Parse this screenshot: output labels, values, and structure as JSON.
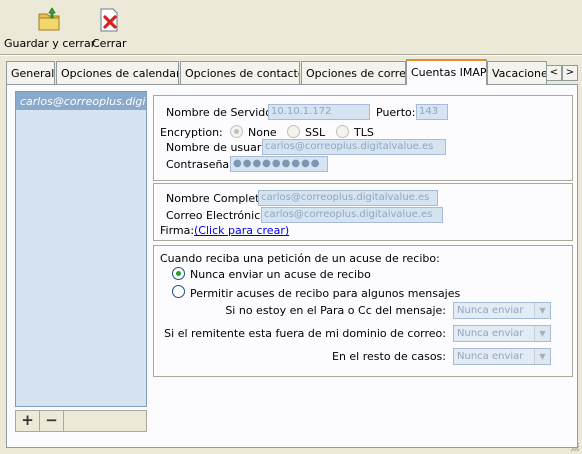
{
  "toolbar": {
    "save_close_label": "Guardar y cerrar",
    "close_label": "Cerrar"
  },
  "tabs": [
    {
      "label": "General"
    },
    {
      "label": "Opciones de calendario"
    },
    {
      "label": "Opciones de contactos"
    },
    {
      "label": "Opciones de correo"
    },
    {
      "label": "Cuentas IMAP"
    },
    {
      "label": "Vacaciones"
    }
  ],
  "tab_nav": {
    "prev": "<",
    "next": ">"
  },
  "accounts": {
    "items": [
      {
        "label": "carlos@correoplus.digitalvalue.es"
      }
    ],
    "add_label": "+",
    "remove_label": "−"
  },
  "server": {
    "server_label": "Nombre de Servidor:",
    "server_value": "10.10.1.172",
    "port_label": "Puerto:",
    "port_value": "143",
    "encryption_label": "Encryption:",
    "enc_none": "None",
    "enc_ssl": "SSL",
    "enc_tls": "TLS",
    "username_label": "Nombre de usuario:",
    "username_value": "carlos@correoplus.digitalvalue.es",
    "password_label": "Contraseña:",
    "password_value": "●●●●●●●●●"
  },
  "identity": {
    "fullname_label": "Nombre Completo:",
    "fullname_value": "carlos@correoplus.digitalvalue.es",
    "email_label": "Correo Electrónico:",
    "email_value": "carlos@correoplus.digitalvalue.es",
    "signature_label": "Firma:",
    "signature_link": "(Click para crear)"
  },
  "receipts": {
    "intro": "Cuando reciba una petición de un acuse de recibo:",
    "never_label": "Nunca enviar un acuse de recibo",
    "allow_label": "Permitir acuses de recibo para algunos mensajes",
    "rule1_label": "Si no estoy en el Para o Cc del mensaje:",
    "rule1_value": "Nunca enviar",
    "rule2_label": "Si el remitente esta fuera de mi dominio de correo:",
    "rule2_value": "Nunca enviar",
    "rule3_label": "En el resto de casos:",
    "rule3_value": "Nunca enviar"
  },
  "colors": {
    "active_tab_accent": "#e68b2c",
    "selection": "#8aaacb",
    "field_bg": "#d6e4f2",
    "link": "#0000ee"
  }
}
